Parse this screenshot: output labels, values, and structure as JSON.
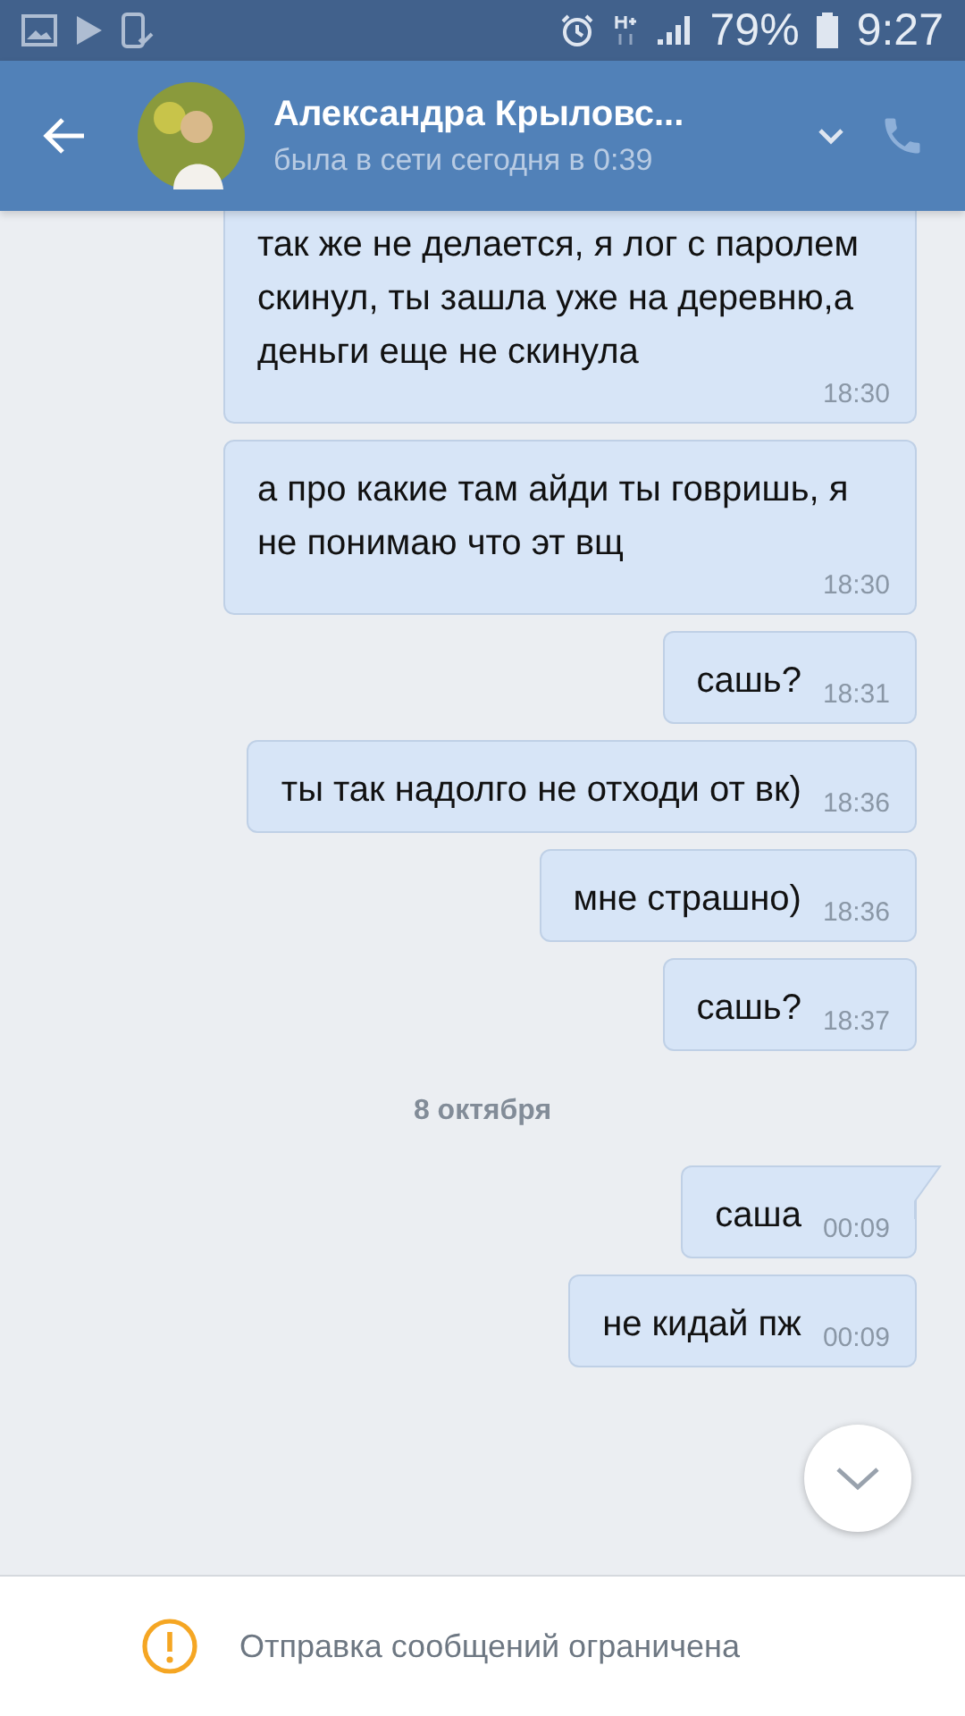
{
  "status_bar": {
    "battery": "79%",
    "time": "9:27"
  },
  "header": {
    "name": "Александра Крыловс...",
    "status": "была в сети сегодня в 0:39"
  },
  "messages": [
    {
      "kind": "message",
      "text": "так же не делается, я лог с паролем скинул, ты зашла уже на деревню,а деньги еще не скинула",
      "time": "18:30",
      "tail": false,
      "cut_top": true
    },
    {
      "kind": "message",
      "text": "а про какие там айди ты говришь, я не понимаю что эт вщ",
      "time": "18:30",
      "tail": false,
      "cut_top": false
    },
    {
      "kind": "message",
      "text": "сашь?",
      "time": "18:31",
      "tail": false,
      "cut_top": false
    },
    {
      "kind": "message",
      "text": "ты так надолго не отходи от вк)",
      "time": "18:36",
      "tail": false,
      "cut_top": false
    },
    {
      "kind": "message",
      "text": "мне страшно)",
      "time": "18:36",
      "tail": false,
      "cut_top": false
    },
    {
      "kind": "message",
      "text": "сашь?",
      "time": "18:37",
      "tail": false,
      "cut_top": false
    },
    {
      "kind": "date",
      "text": "8 октября"
    },
    {
      "kind": "message",
      "text": "саша",
      "time": "00:09",
      "tail": true,
      "cut_top": false
    },
    {
      "kind": "message",
      "text": "не кидай пж",
      "time": "00:09",
      "tail": false,
      "cut_top": false
    }
  ],
  "notice": "Отправка сообщений ограничена"
}
